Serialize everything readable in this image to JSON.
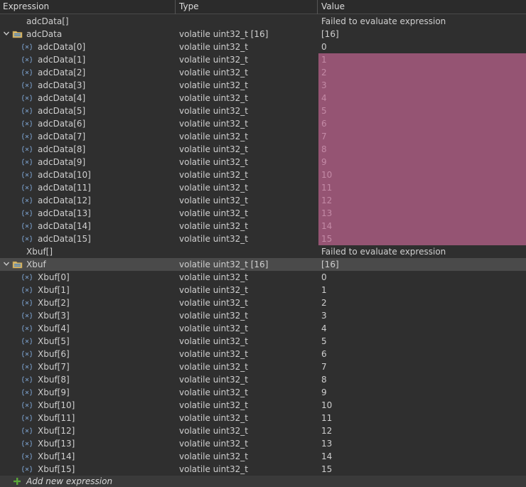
{
  "header": {
    "expression": "Expression",
    "type": "Type",
    "value": "Value"
  },
  "colors": {
    "changed_bg": "#955473",
    "changed_text": "#c38aa6",
    "selected_bg": "#4a4a4a"
  },
  "groups": [
    {
      "placeholder": {
        "name": "adcData[]",
        "value": "Failed to evaluate expression"
      },
      "root": {
        "name": "adcData",
        "type": "volatile uint32_t [16]",
        "value": "[16]",
        "expanded": true,
        "selected": false,
        "icon": "array-folder-icon"
      },
      "children": [
        {
          "name": "adcData[0]",
          "type": "volatile uint32_t",
          "value": "0",
          "changed": false
        },
        {
          "name": "adcData[1]",
          "type": "volatile uint32_t",
          "value": "1",
          "changed": true
        },
        {
          "name": "adcData[2]",
          "type": "volatile uint32_t",
          "value": "2",
          "changed": true
        },
        {
          "name": "adcData[3]",
          "type": "volatile uint32_t",
          "value": "3",
          "changed": true
        },
        {
          "name": "adcData[4]",
          "type": "volatile uint32_t",
          "value": "4",
          "changed": true
        },
        {
          "name": "adcData[5]",
          "type": "volatile uint32_t",
          "value": "5",
          "changed": true
        },
        {
          "name": "adcData[6]",
          "type": "volatile uint32_t",
          "value": "6",
          "changed": true
        },
        {
          "name": "adcData[7]",
          "type": "volatile uint32_t",
          "value": "7",
          "changed": true
        },
        {
          "name": "adcData[8]",
          "type": "volatile uint32_t",
          "value": "8",
          "changed": true
        },
        {
          "name": "adcData[9]",
          "type": "volatile uint32_t",
          "value": "9",
          "changed": true
        },
        {
          "name": "adcData[10]",
          "type": "volatile uint32_t",
          "value": "10",
          "changed": true
        },
        {
          "name": "adcData[11]",
          "type": "volatile uint32_t",
          "value": "11",
          "changed": true
        },
        {
          "name": "adcData[12]",
          "type": "volatile uint32_t",
          "value": "12",
          "changed": true
        },
        {
          "name": "adcData[13]",
          "type": "volatile uint32_t",
          "value": "13",
          "changed": true
        },
        {
          "name": "adcData[14]",
          "type": "volatile uint32_t",
          "value": "14",
          "changed": true
        },
        {
          "name": "adcData[15]",
          "type": "volatile uint32_t",
          "value": "15",
          "changed": true
        }
      ]
    },
    {
      "placeholder": {
        "name": "Xbuf[]",
        "value": "Failed to evaluate expression"
      },
      "root": {
        "name": "Xbuf",
        "type": "volatile uint32_t [16]",
        "value": "[16]",
        "expanded": true,
        "selected": true,
        "icon": "array-folder-icon"
      },
      "children": [
        {
          "name": "Xbuf[0]",
          "type": "volatile uint32_t",
          "value": "0",
          "changed": false
        },
        {
          "name": "Xbuf[1]",
          "type": "volatile uint32_t",
          "value": "1",
          "changed": false
        },
        {
          "name": "Xbuf[2]",
          "type": "volatile uint32_t",
          "value": "2",
          "changed": false
        },
        {
          "name": "Xbuf[3]",
          "type": "volatile uint32_t",
          "value": "3",
          "changed": false
        },
        {
          "name": "Xbuf[4]",
          "type": "volatile uint32_t",
          "value": "4",
          "changed": false
        },
        {
          "name": "Xbuf[5]",
          "type": "volatile uint32_t",
          "value": "5",
          "changed": false
        },
        {
          "name": "Xbuf[6]",
          "type": "volatile uint32_t",
          "value": "6",
          "changed": false
        },
        {
          "name": "Xbuf[7]",
          "type": "volatile uint32_t",
          "value": "7",
          "changed": false
        },
        {
          "name": "Xbuf[8]",
          "type": "volatile uint32_t",
          "value": "8",
          "changed": false
        },
        {
          "name": "Xbuf[9]",
          "type": "volatile uint32_t",
          "value": "9",
          "changed": false
        },
        {
          "name": "Xbuf[10]",
          "type": "volatile uint32_t",
          "value": "10",
          "changed": false
        },
        {
          "name": "Xbuf[11]",
          "type": "volatile uint32_t",
          "value": "11",
          "changed": false
        },
        {
          "name": "Xbuf[12]",
          "type": "volatile uint32_t",
          "value": "12",
          "changed": false
        },
        {
          "name": "Xbuf[13]",
          "type": "volatile uint32_t",
          "value": "13",
          "changed": false
        },
        {
          "name": "Xbuf[14]",
          "type": "volatile uint32_t",
          "value": "14",
          "changed": false
        },
        {
          "name": "Xbuf[15]",
          "type": "volatile uint32_t",
          "value": "15",
          "changed": false
        }
      ]
    }
  ],
  "footer": {
    "add_label": "Add new expression",
    "icon": "plus-icon"
  }
}
